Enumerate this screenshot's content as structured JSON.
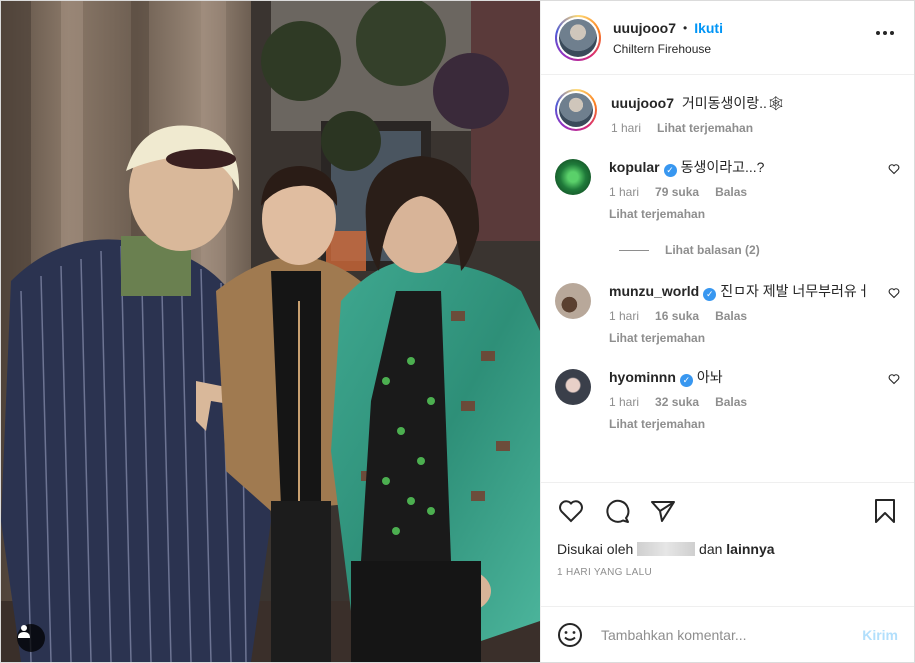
{
  "header": {
    "username": "uuujooo7",
    "separator": "•",
    "follow_label": "Ikuti",
    "location": "Chiltern Firehouse",
    "more_icon": "more-horizontal-icon"
  },
  "caption": {
    "username": "uuujooo7",
    "text": "거미동생이랑..🕸",
    "time": "1 hari",
    "translate": "Lihat terjemahan"
  },
  "comments": [
    {
      "username": "kopular",
      "verified": true,
      "text": "동생이라고...?",
      "time": "1 hari",
      "likes": "79 suka",
      "reply": "Balas",
      "translate": "Lihat terjemahan",
      "avatar_color": "#1f7a3a"
    },
    {
      "username": "munzu_world",
      "verified": true,
      "text": "진ㅁ자 제발 너무부러유ㅓ",
      "time": "1 hari",
      "likes": "16 suka",
      "reply": "Balas",
      "translate": "Lihat terjemahan",
      "avatar_color": "#b8a89a"
    },
    {
      "username": "hyominnn",
      "verified": true,
      "text": "아놔",
      "time": "1 hari",
      "likes": "32 suka",
      "reply": "Balas",
      "translate": "Lihat terjemahan",
      "avatar_color": "#3a3f4a"
    }
  ],
  "view_replies": "Lihat balasan (2)",
  "liked_by": {
    "prefix": "Disukai oleh",
    "middle": "dan",
    "others": "lainnya"
  },
  "post_time": "1 HARI YANG LALU",
  "add_comment": {
    "placeholder": "Tambahkan komentar...",
    "post_label": "Kirim"
  },
  "colors": {
    "accent": "#0095f6",
    "post_disabled": "#b2dffc",
    "verified": "#3897f0",
    "muted": "#8e8e8e"
  }
}
